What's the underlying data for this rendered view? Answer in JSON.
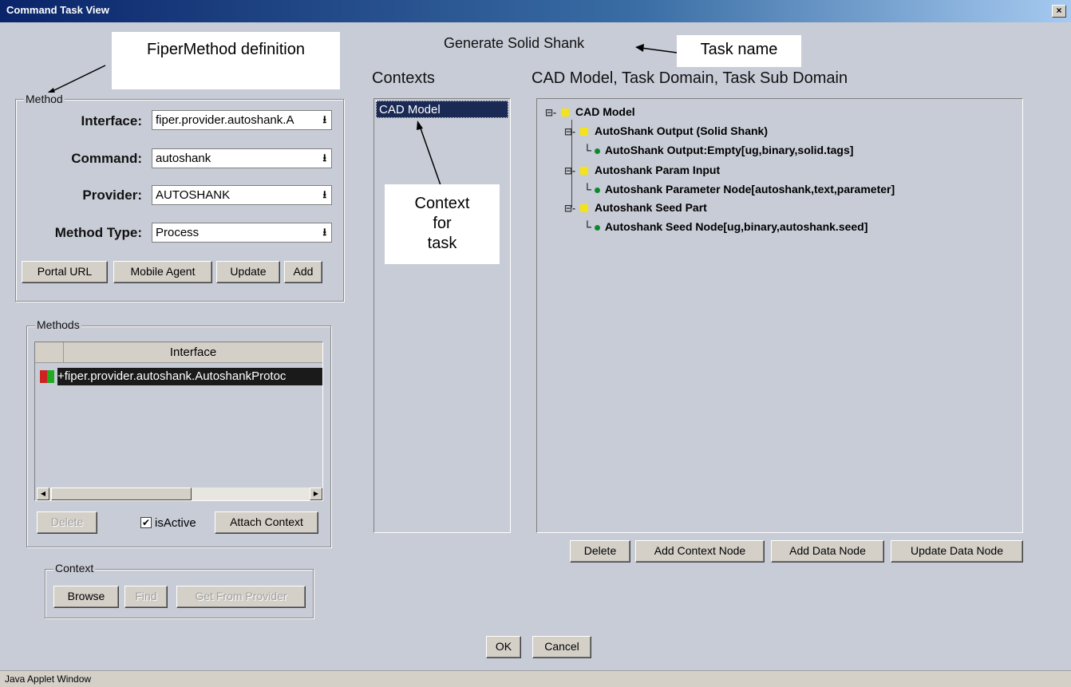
{
  "window": {
    "title": "Command Task View",
    "close_glyph": "×",
    "status": "Java Applet Window"
  },
  "annotations": {
    "method_def": "FiperMethod definition",
    "task_name": "Task name",
    "context_for_task": [
      "Context",
      "for",
      "task"
    ]
  },
  "task_name": "Generate Solid Shank",
  "contexts_heading": "Contexts",
  "domain_heading": "CAD Model, Task Domain, Task Sub Domain",
  "method_group": {
    "legend": "Method",
    "fields": [
      {
        "label": "Interface:",
        "value": "fiper.provider.autoshank.A"
      },
      {
        "label": "Command:",
        "value": "autoshank"
      },
      {
        "label": "Provider:",
        "value": "AUTOSHANK"
      },
      {
        "label": "Method Type:",
        "value": "Process"
      }
    ],
    "buttons": [
      "Portal URL",
      "Mobile Agent",
      "Update",
      "Add"
    ]
  },
  "methods_group": {
    "legend": "Methods",
    "column": "Interface",
    "rows": [
      "+fiper.provider.autoshank.AutoshankProtoc"
    ],
    "delete_label": "Delete",
    "is_active_label": "isActive",
    "is_active_checked": true,
    "attach_label": "Attach Context"
  },
  "context_group": {
    "legend": "Context",
    "buttons": [
      "Browse",
      "Find",
      "Get From Provider"
    ]
  },
  "contexts_list": [
    "CAD Model"
  ],
  "tree": {
    "root": "CAD Model",
    "nodes": [
      {
        "label": "AutoShank Output (Solid Shank)",
        "child": "AutoShank Output:Empty[ug,binary,solid.tags]"
      },
      {
        "label": "Autoshank Param Input",
        "child": "Autoshank Parameter Node[autoshank,text,parameter]"
      },
      {
        "label": "Autoshank Seed Part",
        "child": "Autoshank Seed Node[ug,binary,autoshank.seed]"
      }
    ],
    "buttons": [
      "Delete",
      "Add Context Node",
      "Add Data Node",
      "Update Data Node"
    ]
  },
  "dialog_buttons": {
    "ok": "OK",
    "cancel": "Cancel"
  },
  "icons": {
    "combo_arrow": "down-arrow-icon",
    "tree_toggle": "collapse-icon"
  },
  "colors": {
    "selection": "#1a2a55",
    "title_start": "#0a246a",
    "leaf_dot": "#0b8a2b",
    "folder": "#f4e21a"
  }
}
